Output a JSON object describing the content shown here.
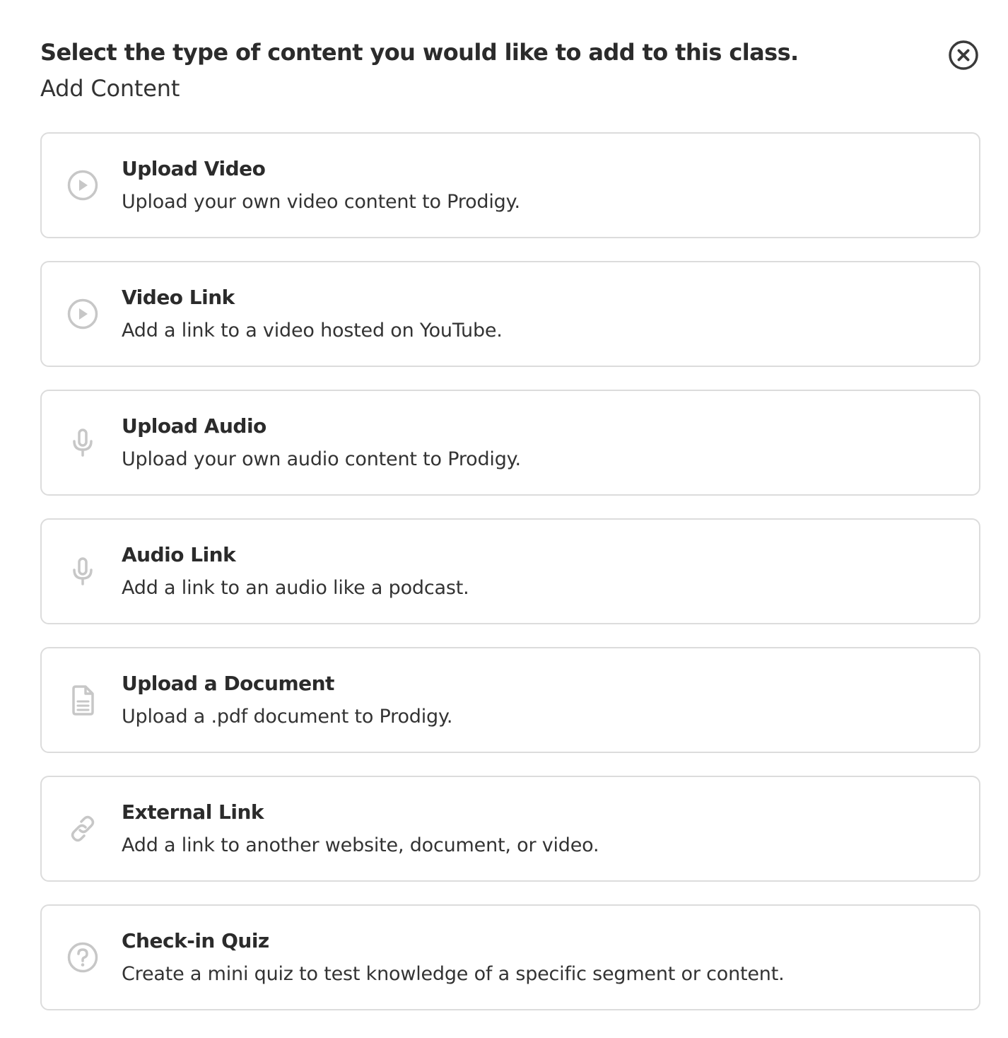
{
  "header": {
    "title": "Select the type of content you would like to add to this class.",
    "subtitle": "Add Content",
    "close_icon": "close-circle-icon"
  },
  "colors": {
    "text": "#2b2b2b",
    "icon": "#c7c7c7",
    "border": "#dcdcdc",
    "close": "#3a3a3a"
  },
  "options": [
    {
      "title": "Upload Video",
      "description": "Upload your own video content to Prodigy.",
      "icon": "play-circle-icon"
    },
    {
      "title": "Video Link",
      "description": "Add a link to a video hosted on YouTube.",
      "icon": "play-circle-icon"
    },
    {
      "title": "Upload Audio",
      "description": "Upload your own audio content to Prodigy.",
      "icon": "microphone-icon"
    },
    {
      "title": "Audio Link",
      "description": "Add a link to an audio like a podcast.",
      "icon": "microphone-icon"
    },
    {
      "title": "Upload a Document",
      "description": "Upload a .pdf document to Prodigy.",
      "icon": "document-icon"
    },
    {
      "title": "External Link",
      "description": "Add a link to another website, document, or video.",
      "icon": "link-icon"
    },
    {
      "title": "Check-in Quiz",
      "description": "Create a mini quiz to test knowledge of a specific segment or content.",
      "icon": "question-circle-icon"
    }
  ]
}
